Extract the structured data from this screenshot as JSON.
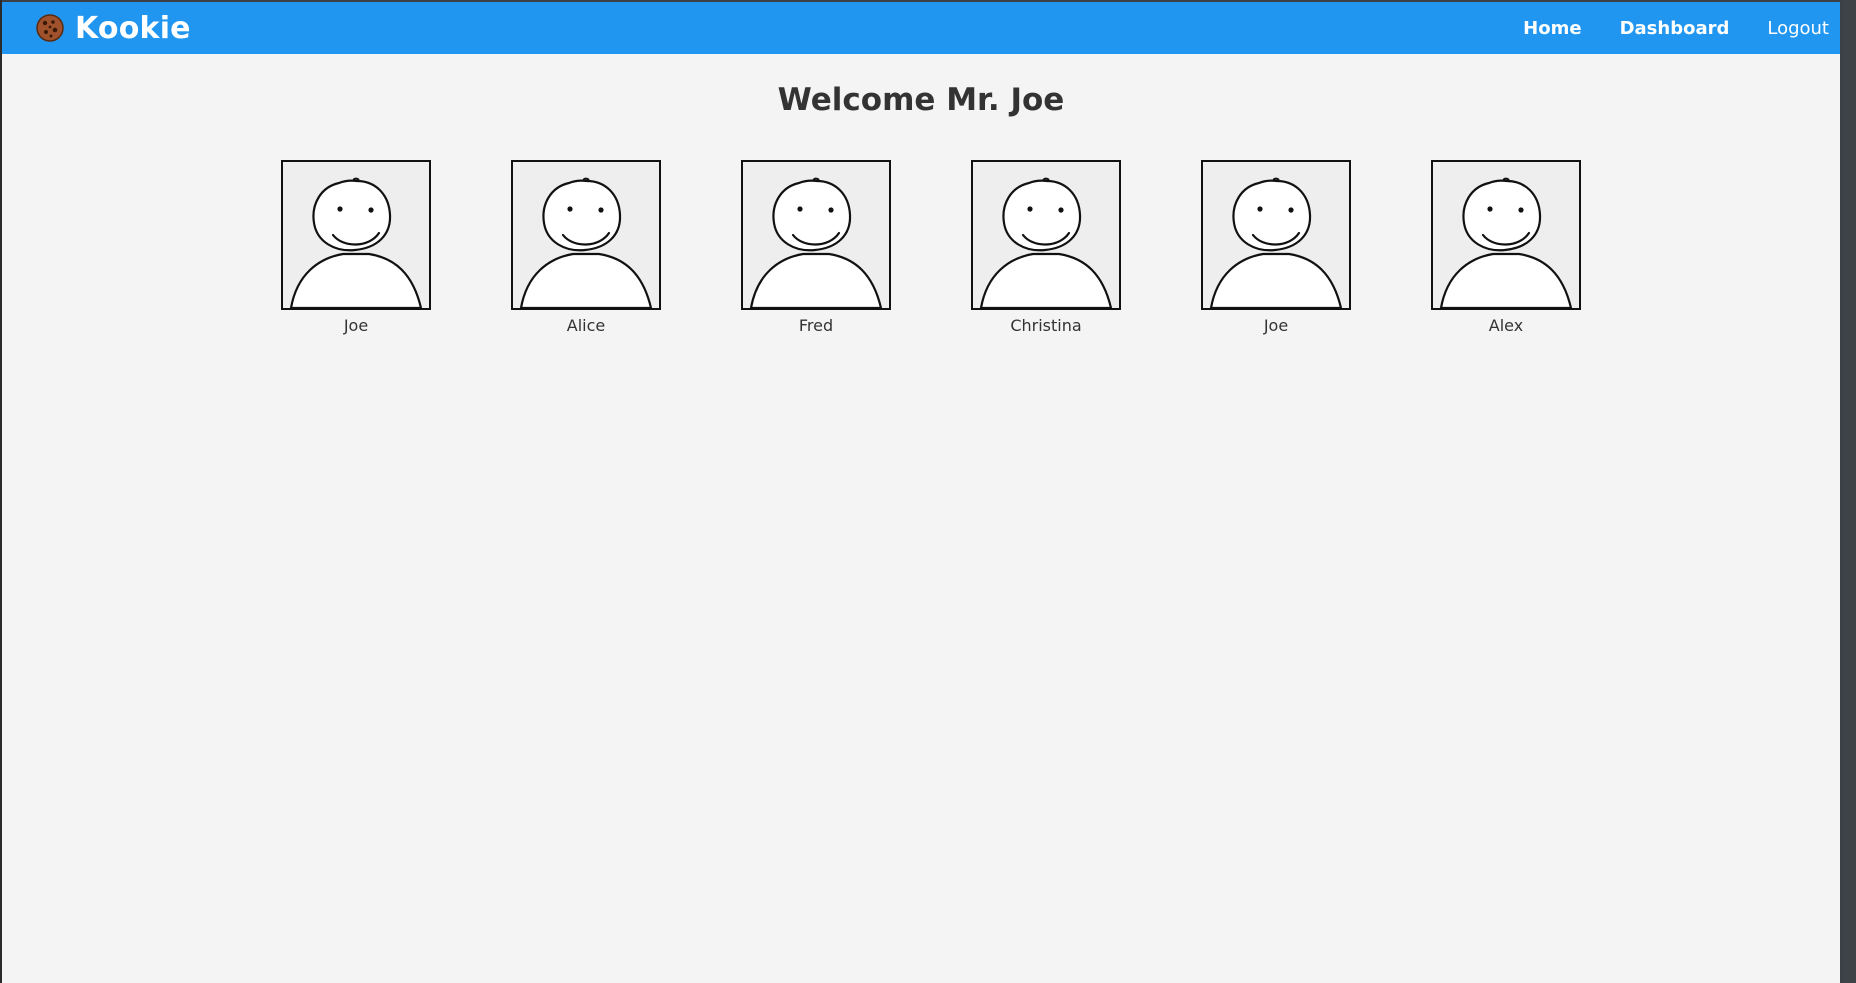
{
  "nav": {
    "brand": "Kookie",
    "brand_icon": "cookie-icon",
    "links": [
      {
        "label": "Home"
      },
      {
        "label": "Dashboard"
      },
      {
        "label": "Logout"
      }
    ]
  },
  "main": {
    "title": "Welcome Mr. Joe",
    "people": [
      {
        "name": "Joe",
        "icon": "avatar-smiley-icon"
      },
      {
        "name": "Alice",
        "icon": "avatar-smiley-icon"
      },
      {
        "name": "Fred",
        "icon": "avatar-smiley-icon"
      },
      {
        "name": "Christina",
        "icon": "avatar-smiley-icon"
      },
      {
        "name": "Joe",
        "icon": "avatar-smiley-icon"
      },
      {
        "name": "Alex",
        "icon": "avatar-smiley-icon"
      }
    ]
  },
  "colors": {
    "navbar": "#2196f0",
    "background": "#f4f4f4",
    "text": "#333333"
  }
}
